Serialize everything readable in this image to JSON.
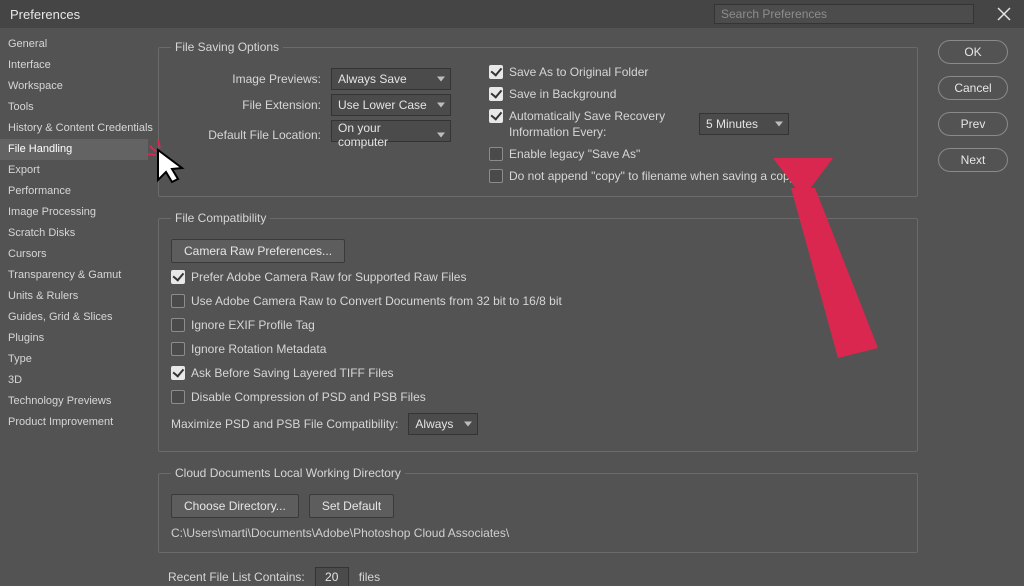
{
  "window": {
    "title": "Preferences",
    "search_placeholder": "Search Preferences"
  },
  "right_buttons": {
    "ok": "OK",
    "cancel": "Cancel",
    "prev": "Prev",
    "next": "Next"
  },
  "sidebar": {
    "items": [
      "General",
      "Interface",
      "Workspace",
      "Tools",
      "History & Content Credentials",
      "File Handling",
      "Export",
      "Performance",
      "Image Processing",
      "Scratch Disks",
      "Cursors",
      "Transparency & Gamut",
      "Units & Rulers",
      "Guides, Grid & Slices",
      "Plugins",
      "Type",
      "3D",
      "Technology Previews",
      "Product Improvement"
    ],
    "selected_index": 5
  },
  "file_saving": {
    "legend": "File Saving Options",
    "image_previews_label": "Image Previews:",
    "image_previews_value": "Always Save",
    "file_extension_label": "File Extension:",
    "file_extension_value": "Use Lower Case",
    "default_location_label": "Default File Location:",
    "default_location_value": "On your computer",
    "cb_save_original": "Save As to Original Folder",
    "cb_save_background": "Save in Background",
    "cb_auto_recovery": "Automatically Save Recovery Information Every:",
    "auto_recovery_interval": "5 Minutes",
    "cb_legacy_saveas": "Enable legacy \"Save As\"",
    "cb_no_copy_suffix": "Do not append \"copy\" to filename when saving a copy"
  },
  "file_compat": {
    "legend": "File Compatibility",
    "camera_raw_btn": "Camera Raw Preferences...",
    "cb_prefer_acr": "Prefer Adobe Camera Raw for Supported Raw Files",
    "cb_use_acr_convert": "Use Adobe Camera Raw to Convert Documents from 32 bit to 16/8 bit",
    "cb_ignore_exif": "Ignore EXIF Profile Tag",
    "cb_ignore_rotation": "Ignore Rotation Metadata",
    "cb_ask_tiff": "Ask Before Saving Layered TIFF Files",
    "cb_disable_compression": "Disable Compression of PSD and PSB Files",
    "max_compat_label": "Maximize PSD and PSB File Compatibility:",
    "max_compat_value": "Always"
  },
  "cloud_dir": {
    "legend": "Cloud Documents Local Working Directory",
    "choose_btn": "Choose Directory...",
    "default_btn": "Set Default",
    "path": "C:\\Users\\marti\\Documents\\Adobe\\Photoshop Cloud Associates\\"
  },
  "recent": {
    "label": "Recent File List Contains:",
    "value": "20",
    "unit": "files"
  }
}
